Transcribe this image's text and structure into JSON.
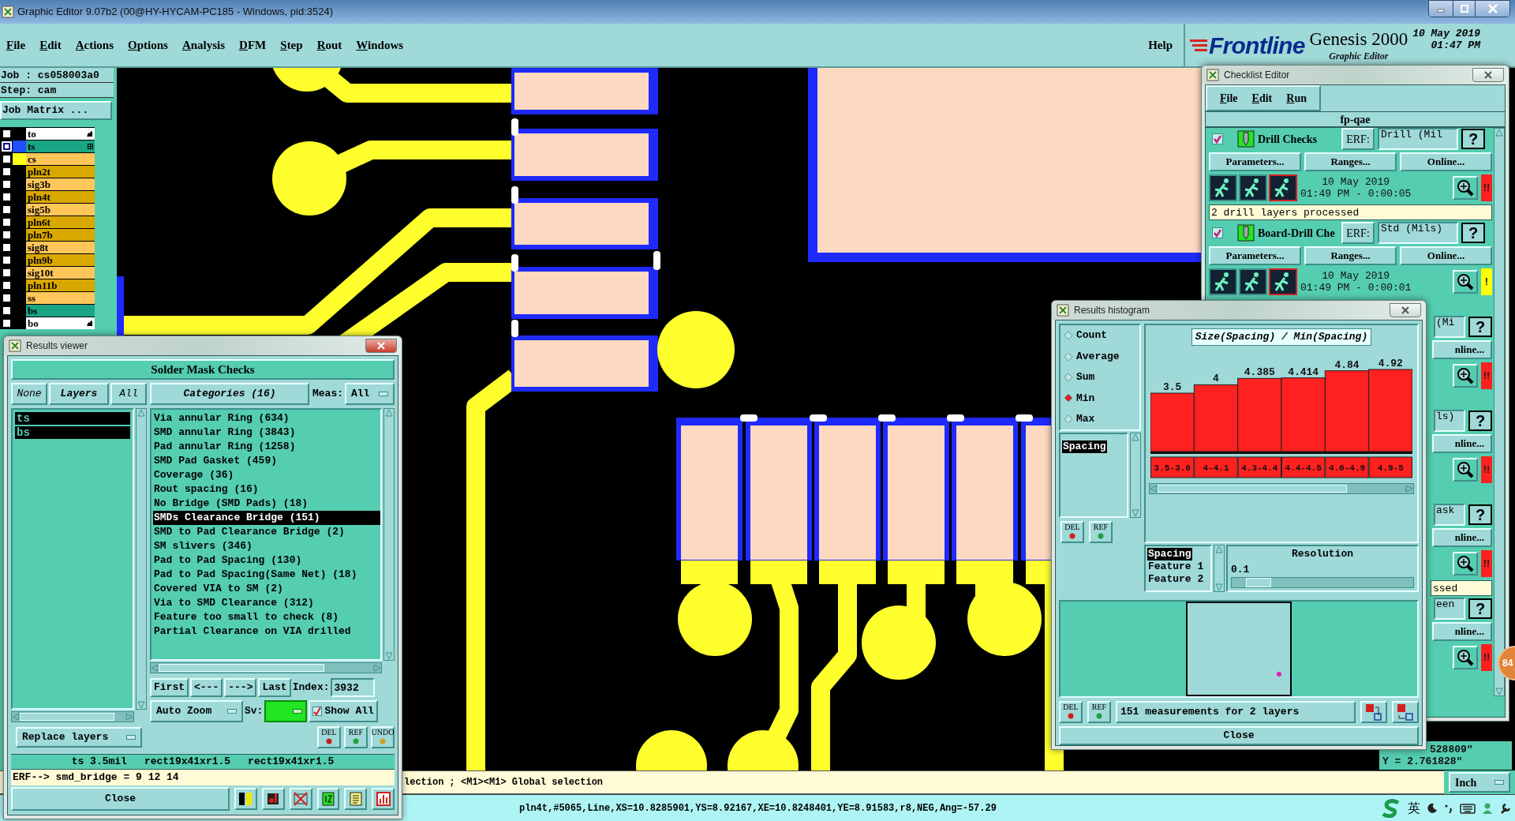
{
  "window": {
    "title": "Graphic Editor 9.07b2 (00@HY-HYCAM-PC185 - Windows, pid:3524)"
  },
  "menu": [
    "File",
    "Edit",
    "Actions",
    "Options",
    "Analysis",
    "DFM",
    "Step",
    "Rout",
    "Windows"
  ],
  "help_menu": "Help",
  "brand": {
    "logo": "Frontline",
    "product": "Genesis 2000",
    "subtitle": "Graphic Editor",
    "date": "10 May 2019",
    "time": "01:47 PM"
  },
  "job_panel": {
    "job": "Job : cs058003a0",
    "step": "Step: cam",
    "matrix_button": "Job Matrix ..."
  },
  "layers": [
    {
      "name": "to",
      "color": "#ffffff",
      "kind": "misc",
      "selected": false
    },
    {
      "name": "ts",
      "color": "#1aa585",
      "kind": "board",
      "selected": true,
      "swatch": {
        "color": "#1f4dff"
      }
    },
    {
      "name": "cs",
      "color": "#ffc65a",
      "kind": "board",
      "selected": false,
      "swatch": {
        "color": "#ffff1e"
      }
    },
    {
      "name": "pln2t",
      "color": "#d9a800",
      "kind": "board",
      "selected": false
    },
    {
      "name": "sig3b",
      "color": "#ffc65a",
      "kind": "board",
      "selected": false
    },
    {
      "name": "pln4t",
      "color": "#d9a800",
      "kind": "board",
      "selected": false
    },
    {
      "name": "sig5b",
      "color": "#ffc65a",
      "kind": "board",
      "selected": false
    },
    {
      "name": "pln6t",
      "color": "#d9a800",
      "kind": "board",
      "selected": false
    },
    {
      "name": "pln7b",
      "color": "#d9a800",
      "kind": "board",
      "selected": false
    },
    {
      "name": "sig8t",
      "color": "#ffc65a",
      "kind": "board",
      "selected": false
    },
    {
      "name": "pln9b",
      "color": "#d9a800",
      "kind": "board",
      "selected": false
    },
    {
      "name": "sig10t",
      "color": "#ffc65a",
      "kind": "board",
      "selected": false
    },
    {
      "name": "pln11b",
      "color": "#d9a800",
      "kind": "board",
      "selected": false
    },
    {
      "name": "ss",
      "color": "#ffc65a",
      "kind": "board",
      "selected": false
    },
    {
      "name": "bs",
      "color": "#1aa585",
      "kind": "board",
      "selected": false
    },
    {
      "name": "bo",
      "color": "#ffffff",
      "kind": "misc",
      "selected": false
    }
  ],
  "results_viewer": {
    "title": "Results viewer",
    "header": "Solder Mask Checks",
    "layer_buttons": [
      "None",
      "Layers",
      "All"
    ],
    "layers": [
      {
        "name": "ts",
        "selected": true
      },
      {
        "name": "bs",
        "selected": true
      }
    ],
    "replace_dropdown": "Replace layers",
    "categories_header": "Categories (16)",
    "meas_label": "Meas:",
    "meas_value": "All",
    "categories": [
      {
        "label": "Via annular Ring (634)",
        "selected": false
      },
      {
        "label": "SMD annular Ring (3843)",
        "selected": false
      },
      {
        "label": "Pad annular Ring (1258)",
        "selected": false
      },
      {
        "label": "SMD Pad Gasket (459)",
        "selected": false
      },
      {
        "label": "Coverage (36)",
        "selected": false
      },
      {
        "label": "Rout spacing (16)",
        "selected": false
      },
      {
        "label": "No Bridge (SMD Pads) (18)",
        "selected": false
      },
      {
        "label": "SMDs Clearance Bridge (151)",
        "selected": true
      },
      {
        "label": "SMD to Pad Clearance Bridge (2)",
        "selected": false
      },
      {
        "label": "SM slivers (346)",
        "selected": false
      },
      {
        "label": "Pad to Pad Spacing (130)",
        "selected": false
      },
      {
        "label": "Pad to Pad Spacing(Same Net) (18)",
        "selected": false
      },
      {
        "label": "Covered VIA to SM (2)",
        "selected": false
      },
      {
        "label": "Via to SMD Clearance (312)",
        "selected": false
      },
      {
        "label": "Feature too small to check (8)",
        "selected": false
      },
      {
        "label": "Partial Clearance on VIA drilled",
        "selected": false
      }
    ],
    "nav_buttons": [
      "First",
      "<---",
      "--->",
      "Last"
    ],
    "index_label": "Index:",
    "index_value": "3932",
    "zoom_dropdown": "Auto Zoom",
    "sv_label": "Sv:",
    "show_all": {
      "label": "Show All",
      "checked": true
    },
    "tool_buttons": [
      "DEL",
      "REF",
      "UNDO"
    ],
    "info_fields": [
      "ts 3.5mil",
      "rect19x41xr1.5",
      "rect19x41xr1.5"
    ],
    "erf_line": "ERF--> smd_bridge = 9 12 14",
    "close": "Close"
  },
  "checklist": {
    "title": "Checklist Editor",
    "menu": [
      "File",
      "Edit",
      "Run"
    ],
    "name": "fp-qae",
    "entries": [
      {
        "kind": "full",
        "checked": true,
        "name": "Drill Checks",
        "erf_label": "ERF:",
        "erf_value": "Drill (Mil",
        "help": "?",
        "buttons": [
          "Parameters...",
          "Ranges...",
          "Online..."
        ],
        "date": "10 May 2019",
        "time": "01:49 PM - 0:00:05",
        "status": {
          "color": "#ff2020",
          "text": "!!"
        },
        "message": "2 drill layers processed"
      },
      {
        "kind": "full",
        "checked": true,
        "name": "Board-Drill Che",
        "erf_label": "ERF:",
        "erf_value": "Std (Mils)",
        "help": "?",
        "buttons": [
          "Parameters...",
          "Ranges...",
          "Online..."
        ],
        "date": "10 May 2019",
        "time": "01:49 PM - 0:00:01",
        "status": {
          "color": "#ffff00",
          "text": "!"
        }
      },
      {
        "kind": "partial",
        "erf_value": "(Mi",
        "help": "?",
        "online": "nline...",
        "status": {
          "color": "#ff2020",
          "text": "!!"
        }
      },
      {
        "kind": "partial",
        "erf_value": "ls)",
        "help": "?",
        "online": "nline...",
        "status": {
          "color": "#ff2020",
          "text": "!!"
        }
      },
      {
        "kind": "partial",
        "erf_value": "ask",
        "help": "?",
        "online": "nline...",
        "status": {
          "color": "#ff2020",
          "text": "!!"
        },
        "message": "ssed"
      },
      {
        "kind": "partial",
        "erf_value": "een",
        "help": "?",
        "online": "nline...",
        "status": {
          "color": "#ff2020",
          "text": "!!"
        }
      }
    ]
  },
  "histogram": {
    "title": "Results histogram",
    "modes": [
      {
        "label": "Count",
        "selected": false
      },
      {
        "label": "Average",
        "selected": false
      },
      {
        "label": "Sum",
        "selected": false
      },
      {
        "label": "Min",
        "selected": true
      },
      {
        "label": "Max",
        "selected": false
      }
    ],
    "fields": [
      {
        "label": "Spacing",
        "selected": true
      }
    ],
    "field_buttons": [
      "DEL",
      "REF"
    ],
    "chart_data": {
      "type": "bar",
      "title": "Size(Spacing) / Min(Spacing)",
      "categories": [
        "3.5-3.6",
        "4-4.1",
        "4.3-4.4",
        "4.4-4.5",
        "4.8-4.9",
        "4.9-5"
      ],
      "values": [
        3.5,
        4,
        4.385,
        4.414,
        4.84,
        4.92
      ],
      "value_labels": [
        "3.5",
        "4",
        "4.385",
        "4.414",
        "4.84",
        "4.92"
      ]
    },
    "measures": [
      {
        "label": "Spacing",
        "selected": true
      },
      {
        "label": "Feature 1",
        "selected": false
      },
      {
        "label": "Feature 2",
        "selected": false
      }
    ],
    "resolution_label": "Resolution",
    "resolution_value": "0.1",
    "slider": {
      "level": 0.08
    },
    "summary_buttons": [
      "DEL",
      "REF"
    ],
    "summary": "151 measurements for 2 layers",
    "close": "Close"
  },
  "message_line": "lection ; <M1><M1> Global selection",
  "coordinates": [
    "528809\"",
    "Y = 2.761828\""
  ],
  "units": "Inch",
  "status_bar": "pln4t,#5065,Line,XS=10.8285901,YS=8.92167,XE=10.8248401,YE=8.91583,r8,NEG,Ang=-57.29",
  "ime": "英",
  "badge": "84"
}
